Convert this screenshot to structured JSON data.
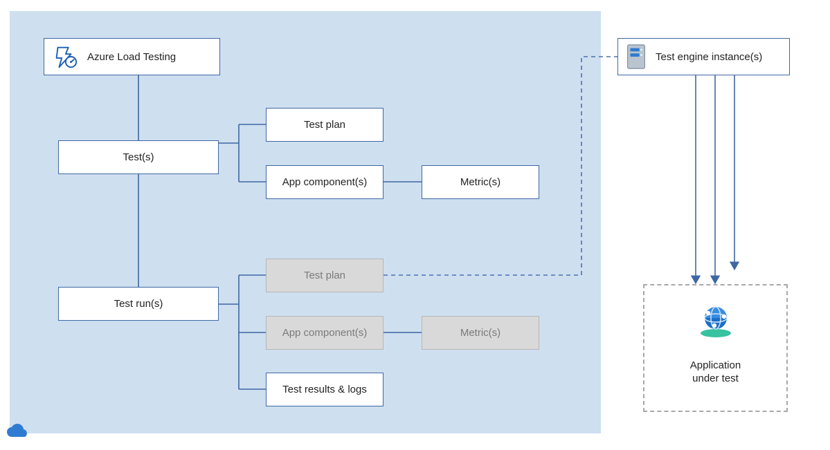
{
  "boxes": {
    "azure_load_testing": "Azure Load Testing",
    "tests": "Test(s)",
    "test_plan": "Test plan",
    "app_components": "App component(s)",
    "metrics": "Metric(s)",
    "test_runs": "Test run(s)",
    "test_plan_snapshot": "Test plan",
    "app_components_snapshot": "App component(s)",
    "metrics_snapshot": "Metric(s)",
    "test_results_logs": "Test results & logs",
    "test_engine_instances": "Test engine instance(s)"
  },
  "application_under_test_line1": "Application",
  "application_under_test_line2": "under test",
  "colors": {
    "panel": "#cedff0",
    "line": "#3e67a3",
    "dashed": "#4d6fb3",
    "snapshot_fill": "#d9d9d9",
    "snapshot_border": "#b6b6b6"
  }
}
